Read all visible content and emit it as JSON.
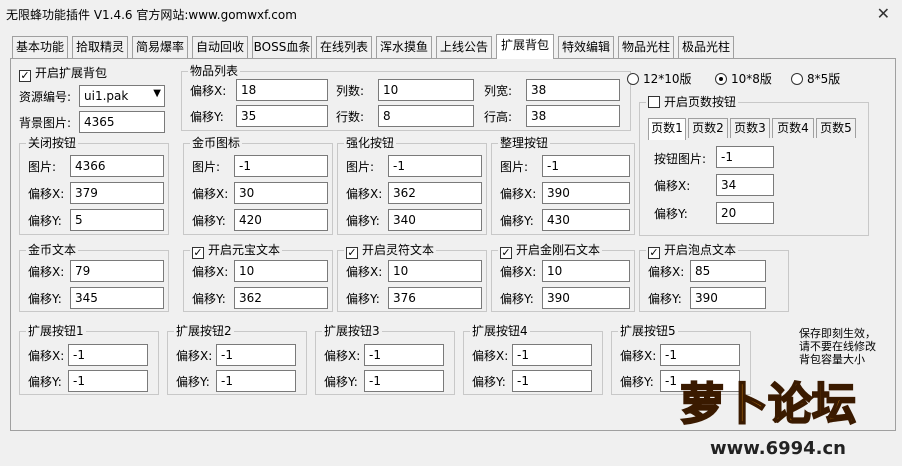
{
  "window": {
    "title": "无限蜂功能插件 V1.4.6  官方网站:www.gomwxf.com",
    "close": "✕"
  },
  "tabs": [
    "基本功能",
    "拾取精灵",
    "简易爆率",
    "自动回收",
    "BOSS血条",
    "在线列表",
    "浑水摸鱼",
    "上线公告",
    "扩展背包",
    "特效编辑",
    "物品光柱",
    "极品光柱"
  ],
  "active_tab": 8,
  "enable_bag": {
    "label": "开启扩展背包",
    "checked": true
  },
  "resource": {
    "label": "资源编号:",
    "value": "ui1.pak"
  },
  "background": {
    "label": "背景图片:",
    "value": "4365"
  },
  "item_list": {
    "title": "物品列表",
    "offset_x_label": "偏移X:",
    "offset_x": "18",
    "offset_y_label": "偏移Y:",
    "offset_y": "35",
    "cols_label": "列数:",
    "cols": "10",
    "rows_label": "行数:",
    "rows": "8",
    "col_w_label": "列宽:",
    "col_w": "38",
    "row_h_label": "行高:",
    "row_h": "38"
  },
  "layout_radio": {
    "options": [
      "12*10版",
      "10*8版",
      "8*5版"
    ],
    "selected": 1
  },
  "page_group": {
    "enable_label": "开启页数按钮",
    "checked": false,
    "tabs": [
      "页数1",
      "页数2",
      "页数3",
      "页数4",
      "页数5"
    ],
    "img_label": "按钮图片:",
    "img": "-1",
    "x_label": "偏移X:",
    "x": "34",
    "y_label": "偏移Y:",
    "y": "20"
  },
  "close_button": {
    "title": "关闭按钮",
    "img_label": "图片:",
    "img": "4366",
    "x_label": "偏移X:",
    "x": "379",
    "y_label": "偏移Y:",
    "y": "5"
  },
  "gold_icon": {
    "title": "金币图标",
    "img_label": "图片:",
    "img": "-1",
    "x_label": "偏移X:",
    "x": "30",
    "y_label": "偏移Y:",
    "y": "420"
  },
  "enhance_button": {
    "title": "强化按钮",
    "img_label": "图片:",
    "img": "-1",
    "x_label": "偏移X:",
    "x": "362",
    "y_label": "偏移Y:",
    "y": "340"
  },
  "sort_button": {
    "title": "整理按钮",
    "img_label": "图片:",
    "img": "-1",
    "x_label": "偏移X:",
    "x": "390",
    "y_label": "偏移Y:",
    "y": "430"
  },
  "gold_text": {
    "title": "金币文本",
    "x_label": "偏移X:",
    "x": "79",
    "y_label": "偏移Y:",
    "y": "345"
  },
  "yuanbao_text": {
    "title": "开启元宝文本",
    "checked": true,
    "x_label": "偏移X:",
    "x": "10",
    "y_label": "偏移Y:",
    "y": "362"
  },
  "lingfu_text": {
    "title": "开启灵符文本",
    "checked": true,
    "x_label": "偏移X:",
    "x": "10",
    "y_label": "偏移Y:",
    "y": "376"
  },
  "diamond_text": {
    "title": "开启金刚石文本",
    "checked": true,
    "x_label": "偏移X:",
    "x": "10",
    "y_label": "偏移Y:",
    "y": "390"
  },
  "bubble_text": {
    "title": "开启泡点文本",
    "checked": true,
    "x_label": "偏移X:",
    "x": "85",
    "y_label": "偏移Y:",
    "y": "390"
  },
  "ext_buttons": [
    {
      "title": "扩展按钮1",
      "x_label": "偏移X:",
      "x": "-1",
      "y_label": "偏移Y:",
      "y": "-1"
    },
    {
      "title": "扩展按钮2",
      "x_label": "偏移X:",
      "x": "-1",
      "y_label": "偏移Y:",
      "y": "-1"
    },
    {
      "title": "扩展按钮3",
      "x_label": "偏移X:",
      "x": "-1",
      "y_label": "偏移Y:",
      "y": "-1"
    },
    {
      "title": "扩展按钮4",
      "x_label": "偏移X:",
      "x": "-1",
      "y_label": "偏移Y:",
      "y": "-1"
    },
    {
      "title": "扩展按钮5",
      "x_label": "偏移X:",
      "x": "-1",
      "y_label": "偏移Y:",
      "y": "-1"
    }
  ],
  "note": "保存即刻生效，请不要在线修改背包容量大小",
  "watermark": {
    "text": "萝卜论坛",
    "url": "www.6994.cn"
  }
}
